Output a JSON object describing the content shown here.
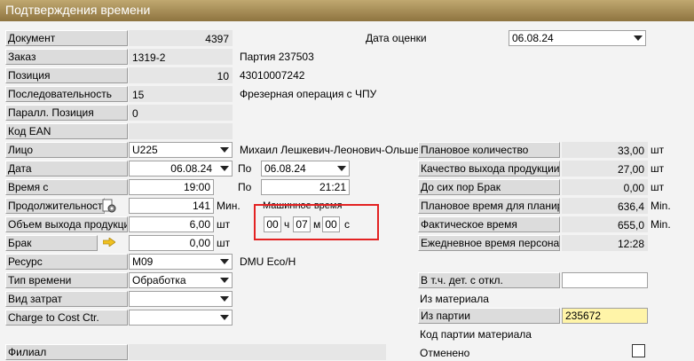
{
  "window": {
    "title": "Подтверждения времени"
  },
  "left": {
    "document": {
      "label": "Документ",
      "value": "4397"
    },
    "order": {
      "label": "Заказ",
      "value": "1319-2",
      "batch_text": "Партия 237503"
    },
    "position": {
      "label": "Позиция",
      "value": "10",
      "item_code": "43010007242"
    },
    "sequence": {
      "label": "Последовательность",
      "value": "15",
      "operation": "Фрезерная операция с ЧПУ"
    },
    "parallel_position": {
      "label": "Паралл. Позиция",
      "value": "0"
    },
    "ean": {
      "label": "Код EAN",
      "value": ""
    },
    "person": {
      "label": "Лицо",
      "value": "U225",
      "name": "Михаил Лешкевич-Леонович-Ольшевский"
    },
    "date": {
      "label": "Дата",
      "value": "06.08.24",
      "to_label": "По",
      "to_value": "06.08.24"
    },
    "time_from": {
      "label": "Время с",
      "value": "19:00",
      "to_label": "По",
      "to_value": "21:21"
    },
    "duration": {
      "label": "Продолжительность",
      "value": "141",
      "unit": "Мин."
    },
    "output_qty": {
      "label": "Объем выхода продукции",
      "value": "6,00",
      "unit": "шт"
    },
    "scrap": {
      "label": "Брак",
      "value": "0,00",
      "unit": "шт"
    },
    "resource": {
      "label": "Ресурс",
      "value": "M09",
      "name": "DMU Eco/H"
    },
    "time_type": {
      "label": "Тип времени",
      "value": "Обработка"
    },
    "cost_type": {
      "label": "Вид затрат",
      "value": ""
    },
    "charge": {
      "label": "Charge to Cost Ctr.",
      "value": ""
    },
    "branch": {
      "label": "Филиал",
      "value": ""
    }
  },
  "machine_time": {
    "label": "Машинное время",
    "hours": "00",
    "hours_unit": "ч",
    "minutes": "07",
    "minutes_unit": "м",
    "seconds": "00",
    "seconds_unit": "с"
  },
  "right": {
    "eval_date": {
      "label": "Дата оценки",
      "value": "06.08.24"
    },
    "planned_qty": {
      "label": "Плановое количество",
      "value": "33,00",
      "unit": "шт"
    },
    "quality_output": {
      "label": "Качество выхода продукции",
      "value": "27,00",
      "unit": "шт"
    },
    "scrap_so_far": {
      "label": "До сих пор Брак",
      "value": "0,00",
      "unit": "шт"
    },
    "planned_time": {
      "label": "Плановое время для планирования",
      "value": "636,4",
      "unit": "Min."
    },
    "actual_time": {
      "label": "Фактическое время",
      "value": "655,0",
      "unit": "Min."
    },
    "daily_time": {
      "label": "Ежедневное время персонала",
      "value": "12:28"
    },
    "incl_deviation": {
      "label": "В т.ч. дет. с откл.",
      "value": ""
    },
    "from_material": {
      "label": "Из материала"
    },
    "from_batch": {
      "label": "Из партии",
      "value": "235672"
    },
    "material_batch_code": {
      "label": "Код партии материала"
    },
    "cancelled": {
      "label": "Отменено"
    }
  }
}
